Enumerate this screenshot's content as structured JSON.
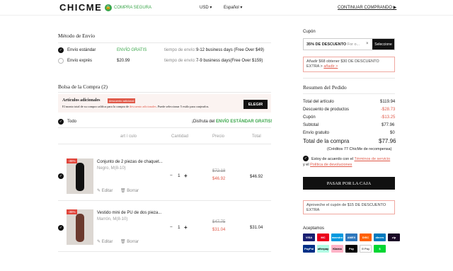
{
  "header": {
    "logo": "CHICME",
    "secure": "COMPRA SEGURA",
    "currency": "USD ▾",
    "language": "Español ▾",
    "continue": "CONTINUAR COMPRANDO ▶"
  },
  "shipping": {
    "title": "Método de Envío",
    "options": [
      {
        "name": "Envío estándar",
        "price": "ENVÍO GRATIS",
        "time_label": "tiempo de envío:",
        "time": "9-12 business days (Free Over $49)",
        "selected": true
      },
      {
        "name": "Envío exprés",
        "price": "$20.99",
        "time_label": "tiempo de envío:",
        "time": "7-9 business days(Free Over $159)",
        "selected": false
      }
    ]
  },
  "bag": {
    "title": "Bolsa de la Compra (2)",
    "promo_title": "Artículos adicionales",
    "promo_badge": "descuento adicional",
    "promo_text_a": "El monto total de su compra califica para la compra de ",
    "promo_text_link": "descuento adicionales",
    "promo_text_b": ". Puede seleccionar 5 estilo para canjearlos.",
    "promo_button": "ELEGIR",
    "select_all": "Todo",
    "free_ship_a": "¡Disfruta del ",
    "free_ship_b": "ENVÍO ESTÁNDAR GRATIS!",
    "columns": [
      "art í culo",
      "Cantidad",
      "Precio",
      "Total"
    ],
    "items": [
      {
        "discount": "-35%",
        "name": "Conjunto de 2 piezas de chaquet...",
        "variant": "Negro, M(8-10)",
        "qty": "1",
        "old_price": "$72.18",
        "price": "$46.92",
        "total": "$46.92",
        "edit": "Editar",
        "delete": "Borrar"
      },
      {
        "discount": "-35%",
        "name": "Vestido mini de PU de dos pieza...",
        "variant": "Marrón, M(8-10)",
        "qty": "1",
        "old_price": "$47.75",
        "price": "$31.04",
        "total": "$31.04",
        "edit": "Editar",
        "delete": "Borrar"
      }
    ]
  },
  "coupon": {
    "title": "Cupón",
    "value_bold": "35% DE DESCUENTO",
    "value_rest": " For o...",
    "apply": "Seleccione",
    "notice_a": "Añadir $68 obtener $30 DE DESCUENTO EXTRA > ",
    "notice_link": "añadir >"
  },
  "summary": {
    "title": "Resumen del Pedido",
    "rows": [
      {
        "label": "Total del artículo",
        "value": "$119.94"
      },
      {
        "label": "Descuento de productos",
        "value": "-$28.73"
      },
      {
        "label": "Cupón",
        "value": "-$13.25"
      },
      {
        "label": "Subtotal",
        "value": "$77.96"
      },
      {
        "label": "Envío gratuito",
        "value": "$0"
      }
    ],
    "total_label": "Total de la compra",
    "total_value": "$77.96",
    "credits": "(Créditos 77 ChicMe de recompensa)",
    "terms_a": "Estoy de acuerdo con el ",
    "terms_link1": "Términos de servicio",
    "terms_b": "y el ",
    "terms_link2": "Política de devoluciones",
    "checkout": "PASAR POR LA CAJA",
    "bottom_notice": "Aproveche el cupón de $15 DE DESCUENTO EXTRA",
    "accept": "Aceptamos",
    "payments": [
      {
        "name": "VISA",
        "color": "#1a1f71"
      },
      {
        "name": "MC",
        "color": "#eb001b"
      },
      {
        "name": "maestro",
        "color": "#0099df"
      },
      {
        "name": "AMEX",
        "color": "#2e77bc"
      },
      {
        "name": "DISC",
        "color": "#ff6000"
      },
      {
        "name": "diners",
        "color": "#0079be"
      },
      {
        "name": "zip",
        "color": "#1a0826"
      },
      {
        "name": "PayPal",
        "color": "#003087"
      },
      {
        "name": "afterpay",
        "color": "#b2fce4"
      },
      {
        "name": "Klarna",
        "color": "#ffb3c7"
      },
      {
        "name": "Pay",
        "color": "#000000"
      },
      {
        "name": "G Pay",
        "color": "#ffffff"
      },
      {
        "name": "$",
        "color": "#00d632"
      }
    ]
  }
}
